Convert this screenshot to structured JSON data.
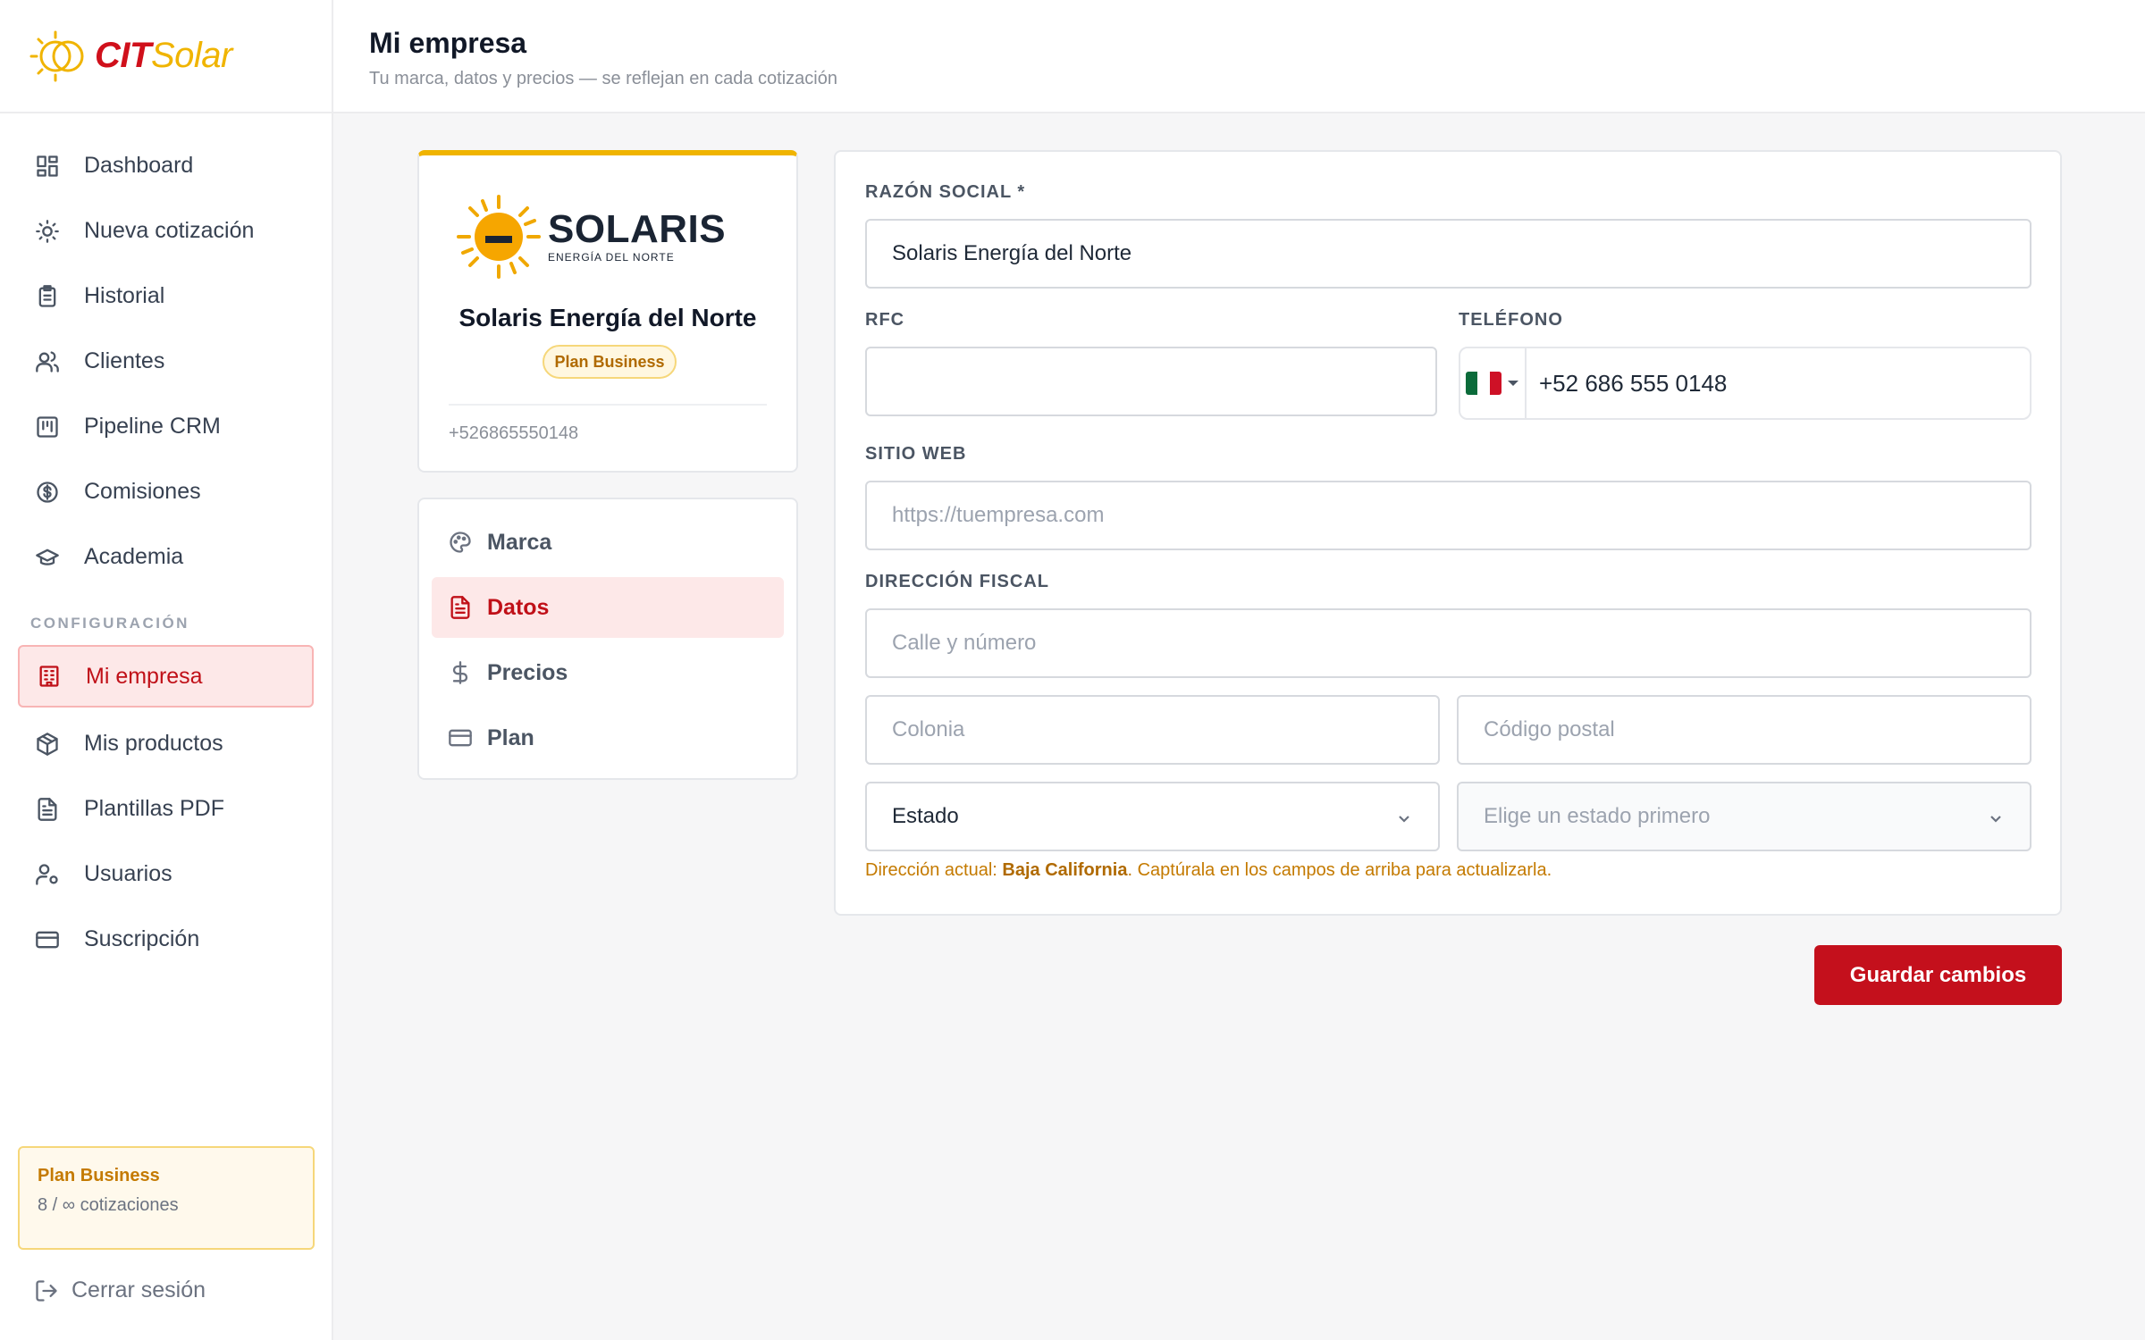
{
  "app": {
    "logo_cit": "CIT",
    "logo_solar": "Solar"
  },
  "sidebar": {
    "items": [
      {
        "label": "Dashboard",
        "icon": "dashboard-icon"
      },
      {
        "label": "Nueva cotización",
        "icon": "sun-icon"
      },
      {
        "label": "Historial",
        "icon": "clipboard-icon"
      },
      {
        "label": "Clientes",
        "icon": "users-icon"
      },
      {
        "label": "Pipeline CRM",
        "icon": "kanban-icon"
      },
      {
        "label": "Comisiones",
        "icon": "dollar-circle-icon"
      },
      {
        "label": "Academia",
        "icon": "graduation-cap-icon"
      }
    ],
    "section_label": "CONFIGURACIÓN",
    "config_items": [
      {
        "label": "Mi empresa",
        "icon": "building-icon",
        "active": true
      },
      {
        "label": "Mis productos",
        "icon": "package-icon"
      },
      {
        "label": "Plantillas PDF",
        "icon": "file-text-icon"
      },
      {
        "label": "Usuarios",
        "icon": "user-cog-icon"
      },
      {
        "label": "Suscripción",
        "icon": "credit-card-icon"
      }
    ],
    "plan": {
      "title": "Plan Business",
      "usage": "8 / ∞ cotizaciones"
    },
    "logout_label": "Cerrar sesión"
  },
  "header": {
    "title": "Mi empresa",
    "subtitle": "Tu marca, datos y precios — se reflejan en cada cotización"
  },
  "profile": {
    "brand_name": "SOLARIS",
    "brand_tagline": "ENERGÍA DEL NORTE",
    "company_name": "Solaris Energía del Norte",
    "plan_badge": "Plan Business",
    "phone": "+526865550148"
  },
  "settings_menu": [
    {
      "label": "Marca",
      "icon": "palette-icon"
    },
    {
      "label": "Datos",
      "icon": "document-icon",
      "active": true
    },
    {
      "label": "Precios",
      "icon": "dollar-icon"
    },
    {
      "label": "Plan",
      "icon": "card-icon"
    }
  ],
  "form": {
    "razon_social": {
      "label": "RAZÓN SOCIAL *",
      "value": "Solaris Energía del Norte"
    },
    "rfc": {
      "label": "RFC",
      "value": ""
    },
    "telefono": {
      "label": "TELÉFONO",
      "value": "+52 686 555 0148",
      "country": "MX"
    },
    "sitio_web": {
      "label": "SITIO WEB",
      "placeholder": "https://tuempresa.com"
    },
    "direccion": {
      "label": "DIRECCIÓN FISCAL",
      "calle_placeholder": "Calle y número",
      "colonia_placeholder": "Colonia",
      "cp_placeholder": "Código postal",
      "estado_value": "Estado",
      "municipio_placeholder": "Elige un estado primero"
    },
    "note_prefix": "Dirección actual: ",
    "note_state": "Baja California",
    "note_suffix": ". Captúrala en los campos de arriba para actualizarla."
  },
  "actions": {
    "save_label": "Guardar cambios"
  },
  "colors": {
    "brand_red": "#c4101c",
    "brand_yellow": "#f0b400",
    "active_bg": "#fde8e8",
    "note": "#c47a00"
  }
}
